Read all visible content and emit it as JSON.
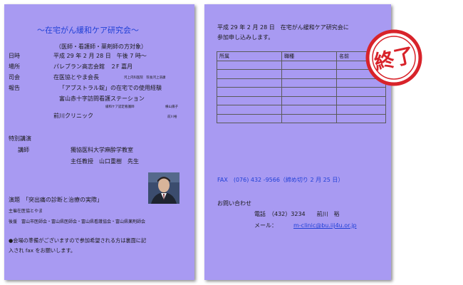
{
  "left": {
    "title": "～在宅がん緩和ケア研究会～",
    "subtitle": "（医師・看護師・薬剤師の方対象）",
    "rows": [
      {
        "label": "日時",
        "value": "平成 29 年 2 月 28 日　午後 7 時～"
      },
      {
        "label": "場所",
        "value": "パレブラン高志会館　２F 嘉月"
      },
      {
        "label": "司会",
        "value": "在医協とやま会長"
      }
    ],
    "chair_note": "河上内科医院　院長河上浩康",
    "report_label": "報告",
    "reports": [
      {
        "title": "「アブストラル錠」の在宅での使用経験"
      },
      {
        "title": "富山赤十字訪問看護ステーション",
        "note": "緩和ケア認定看護師",
        "name": "横山陽子"
      },
      {
        "title": "前川クリニック",
        "name": "前川裕"
      }
    ],
    "special_title": "特別講演",
    "lecturer_label": "講師",
    "lecturer_org": "獨協医科大学麻酔学教室",
    "lecturer_name": "主任教授　山口重樹　先生",
    "topic": "演題　「突出痛の診断と治療の実際」",
    "organizer": "主催在医協とやま",
    "sponsors": "後援　富山市医師会・富山県医師会・富山県看護協会・富山県薬剤師会",
    "note_line1": "●会場の準備がございますので参加希望される方は裏面に記",
    "note_line2": "入され fax をお願いします。"
  },
  "right": {
    "intro_line1": "平成 29 年 2 月 28 日　在宅がん緩和ケア研究会に",
    "intro_line2": "参加申し込みします。",
    "table_headers": [
      "所属",
      "職種",
      "名前"
    ],
    "table_rows": 7,
    "fax": "FAX　(076) 432 -9566（締め切り 2 月 25 日）",
    "contact_title": "お問い合わせ",
    "phone": "電話　（432）3234　　前川　裕",
    "mail_label": "メール：",
    "mail_value": "m-clinic@bu.iij4u.or.jp"
  },
  "stamp": {
    "text": "終了",
    "color": "#d8232a"
  },
  "colors": {
    "paper": "#a89af2",
    "title": "#1f3fd6"
  }
}
